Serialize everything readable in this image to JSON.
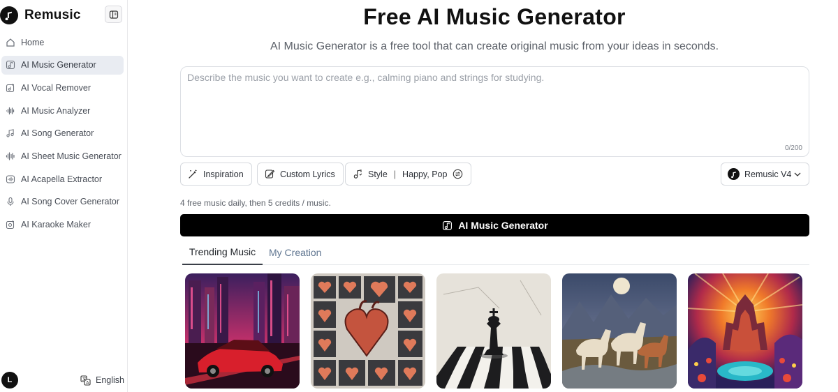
{
  "app": {
    "name": "Remusic"
  },
  "sidebar": {
    "items": [
      {
        "label": "Home",
        "icon": "home-icon"
      },
      {
        "label": "AI Music Generator",
        "icon": "music-note-icon",
        "active": true
      },
      {
        "label": "AI Vocal Remover",
        "icon": "vocal-remover-icon"
      },
      {
        "label": "AI Music Analyzer",
        "icon": "waveform-icon"
      },
      {
        "label": "AI Song Generator",
        "icon": "song-notes-icon"
      },
      {
        "label": "AI Sheet Music Generator",
        "icon": "sheet-waveform-icon"
      },
      {
        "label": "AI Acapella Extractor",
        "icon": "acapella-icon"
      },
      {
        "label": "AI Song Cover Generator",
        "icon": "microphone-icon"
      },
      {
        "label": "AI Karaoke Maker",
        "icon": "karaoke-icon"
      }
    ],
    "user_initial": "L",
    "language": "English"
  },
  "main": {
    "title": "Free AI Music Generator",
    "subtitle": "AI Music Generator is a free tool that can create original music from your ideas in seconds.",
    "prompt": {
      "placeholder": "Describe the music you want to create e.g., calming piano and strings for studying.",
      "value": "",
      "counter": "0/200"
    },
    "options": {
      "inspiration_label": "Inspiration",
      "custom_lyrics_label": "Custom Lyrics",
      "style_label": "Style",
      "style_separator": "|",
      "style_value": "Happy, Pop"
    },
    "model": {
      "selected": "Remusic V4"
    },
    "credits_note": "4 free music daily, then 5 credits / music.",
    "generate_label": "AI Music Generator",
    "tabs": [
      {
        "label": "Trending Music",
        "active": true
      },
      {
        "label": "My Creation",
        "active": false
      }
    ],
    "cards": [
      {
        "thumbnail": "neon-city-car"
      },
      {
        "thumbnail": "hearts-grid"
      },
      {
        "thumbnail": "chess-king"
      },
      {
        "thumbnail": "horses-moon"
      },
      {
        "thumbnail": "psychedelic-temple"
      }
    ]
  },
  "colors": {
    "accent": "#000000",
    "active_nav_bg": "#e9ecf2",
    "tab_inactive": "#5f7590"
  }
}
